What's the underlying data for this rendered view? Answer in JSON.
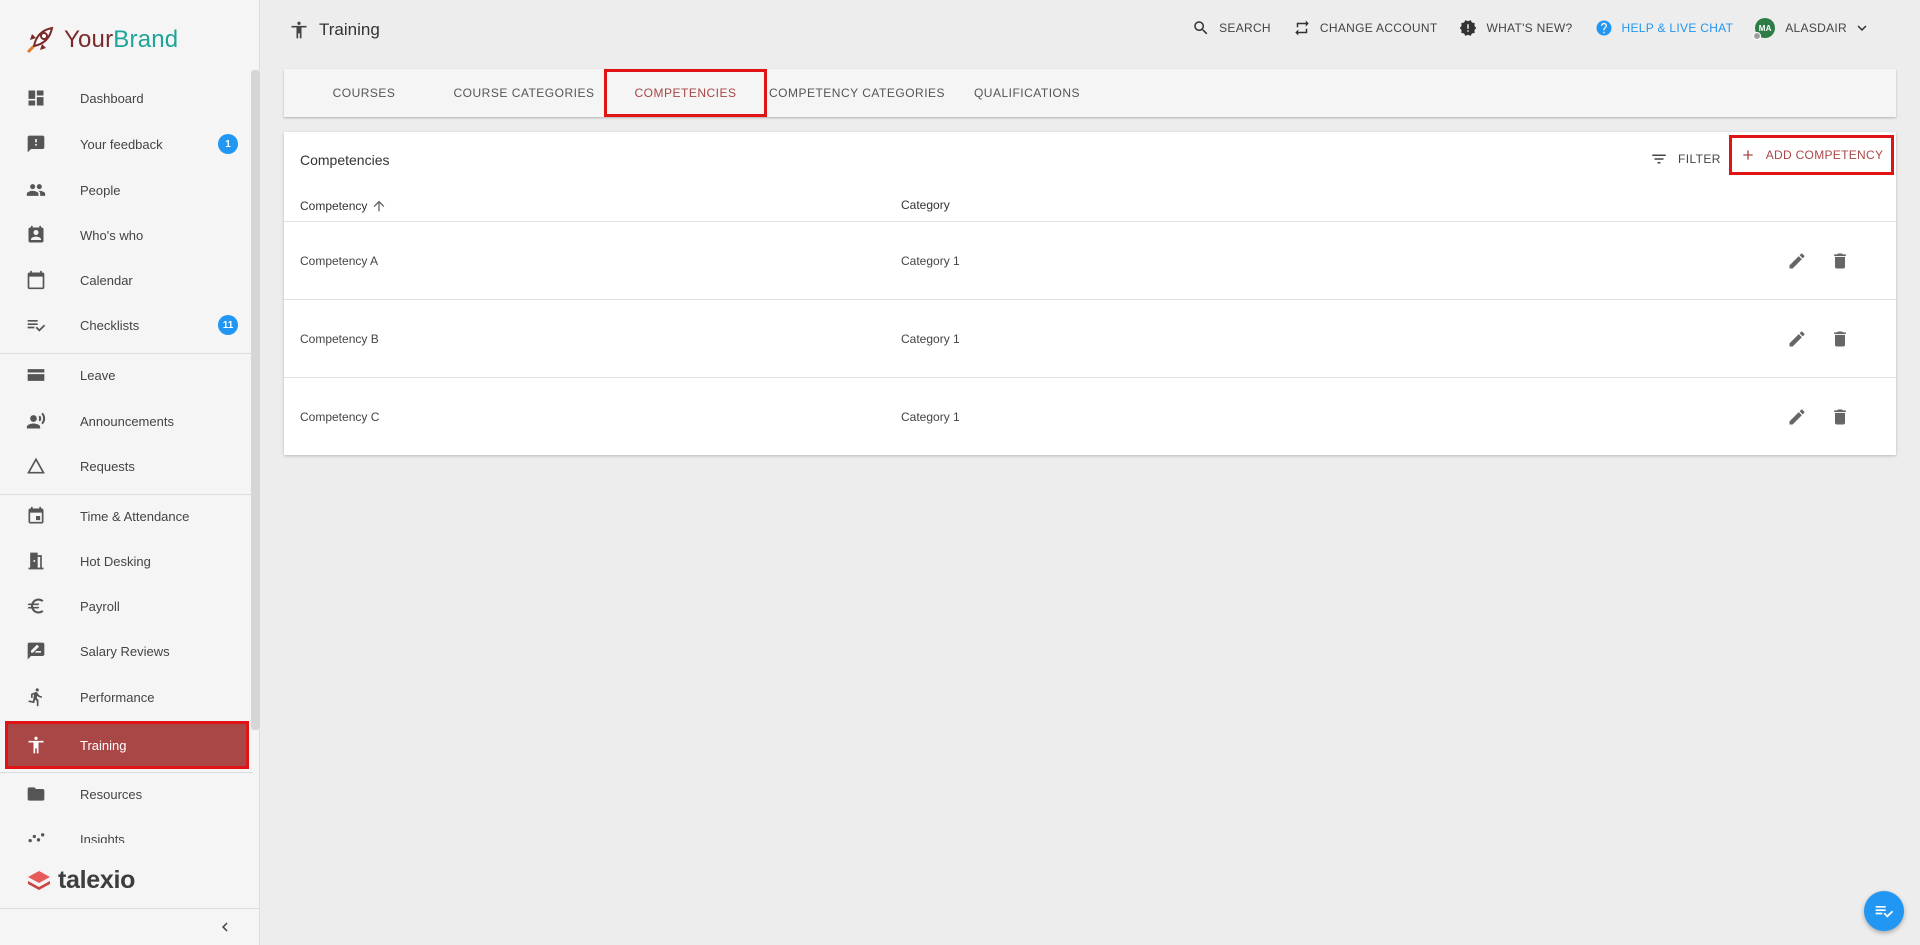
{
  "brand": {
    "name_part1": "Your",
    "name_part2": "Brand",
    "logo_icon": "rocket-icon"
  },
  "sidebar": {
    "items": [
      {
        "label": "Dashboard",
        "icon": "dashboard-icon"
      },
      {
        "label": "Your feedback",
        "icon": "feedback-icon",
        "badge": "1"
      },
      {
        "label": "People",
        "icon": "people-icon"
      },
      {
        "label": "Who's who",
        "icon": "contact-card-icon"
      },
      {
        "label": "Calendar",
        "icon": "calendar-icon"
      },
      {
        "label": "Checklists",
        "icon": "checklist-icon",
        "badge": "11"
      },
      {
        "label": "Leave",
        "icon": "leave-icon"
      },
      {
        "label": "Announcements",
        "icon": "announcement-icon"
      },
      {
        "label": "Requests",
        "icon": "warning-triangle-icon"
      },
      {
        "label": "Time & Attendance",
        "icon": "event-icon"
      },
      {
        "label": "Hot Desking",
        "icon": "door-icon"
      },
      {
        "label": "Payroll",
        "icon": "euro-icon"
      },
      {
        "label": "Salary Reviews",
        "icon": "rate-review-icon"
      },
      {
        "label": "Performance",
        "icon": "running-person-icon"
      },
      {
        "label": "Training",
        "icon": "accessibility-icon",
        "active": true
      },
      {
        "label": "Resources",
        "icon": "folder-icon"
      },
      {
        "label": "Insights",
        "icon": "insights-icon"
      }
    ],
    "footer_logo": "talexio",
    "collapse_icon": "chevron-left-icon"
  },
  "header": {
    "title": "Training",
    "actions": {
      "search": "SEARCH",
      "change_account": "CHANGE ACCOUNT",
      "whats_new": "WHAT'S NEW?",
      "help": "HELP & LIVE CHAT",
      "user_initials": "MA",
      "user_name": "ALASDAIR"
    }
  },
  "tabs": [
    {
      "label": "COURSES"
    },
    {
      "label": "COURSE CATEGORIES"
    },
    {
      "label": "COMPETENCIES",
      "active": true
    },
    {
      "label": "COMPETENCY CATEGORIES"
    },
    {
      "label": "QUALIFICATIONS"
    }
  ],
  "card": {
    "title": "Competencies",
    "filter_label": "FILTER",
    "add_label": "ADD COMPETENCY",
    "columns": {
      "competency": "Competency",
      "category": "Category"
    },
    "rows": [
      {
        "competency": "Competency A",
        "category": "Category 1"
      },
      {
        "competency": "Competency B",
        "category": "Category 1"
      },
      {
        "competency": "Competency C",
        "category": "Category 1"
      }
    ]
  },
  "colors": {
    "accent": "#a94646",
    "highlight": "#e01414",
    "info": "#2196f3",
    "brand_teal": "#1ea49a"
  }
}
